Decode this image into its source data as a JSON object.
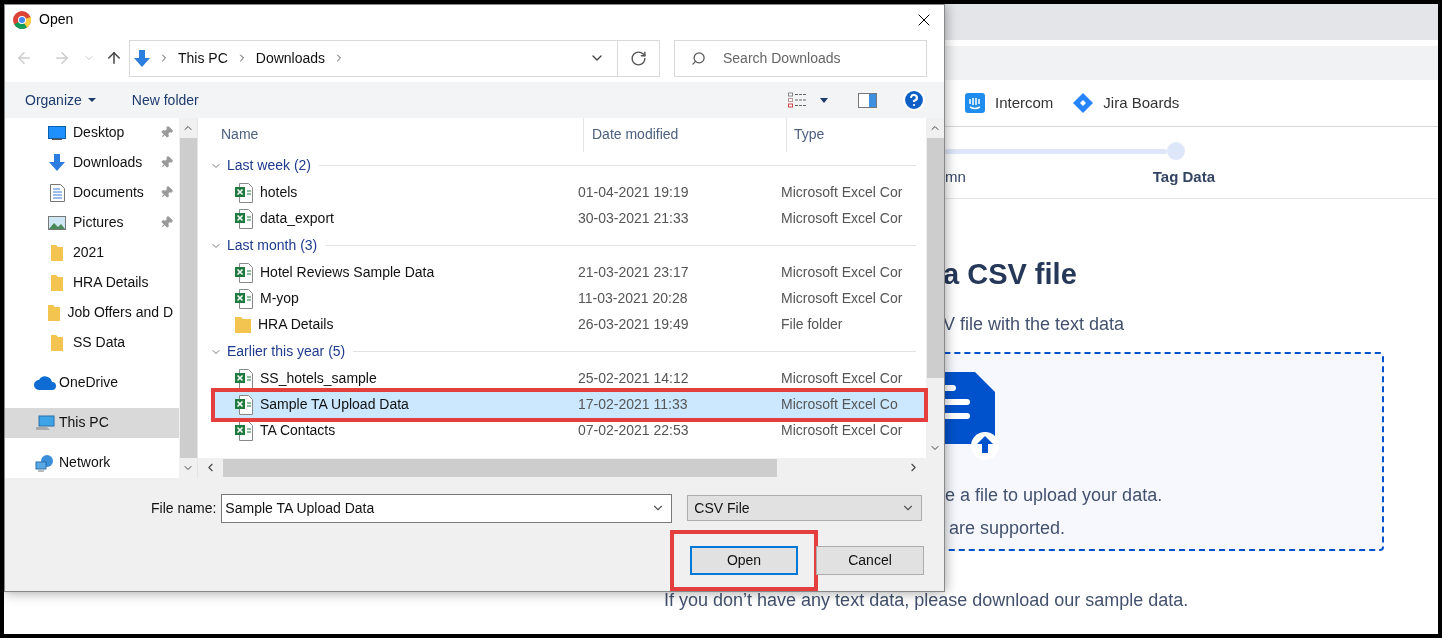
{
  "dialog": {
    "title": "Open",
    "breadcrumb": [
      "This PC",
      "Downloads"
    ],
    "search": {
      "placeholder": "Search Downloads"
    },
    "toolbar": {
      "organize": "Organize",
      "new_folder": "New folder"
    },
    "nav_pane": {
      "quick_access": [
        {
          "label": "Desktop",
          "kind": "desktop",
          "pinned": true,
          "selected": false
        },
        {
          "label": "Downloads",
          "kind": "downloads",
          "pinned": true,
          "selected": false
        },
        {
          "label": "Documents",
          "kind": "documents",
          "pinned": true,
          "selected": false
        },
        {
          "label": "Pictures",
          "kind": "pictures",
          "pinned": true,
          "selected": false
        },
        {
          "label": "2021",
          "kind": "folder",
          "pinned": false,
          "selected": false
        },
        {
          "label": "HRA Details",
          "kind": "folder",
          "pinned": false,
          "selected": false
        },
        {
          "label": "Job Offers and D",
          "kind": "folder",
          "pinned": false,
          "selected": false
        },
        {
          "label": "SS Data",
          "kind": "folder",
          "pinned": false,
          "selected": false
        }
      ],
      "locations": [
        {
          "label": "OneDrive",
          "kind": "cloud",
          "selected": false
        },
        {
          "label": "This PC",
          "kind": "pc",
          "selected": true
        },
        {
          "label": "Network",
          "kind": "network",
          "selected": false
        }
      ]
    },
    "columns": [
      "Name",
      "Date modified",
      "Type"
    ],
    "groups": [
      {
        "label": "Last week (2)",
        "expanded": true,
        "files": [
          {
            "name": "hotels",
            "date": "01-04-2021 19:19",
            "type": "Microsoft Excel Cor",
            "kind": "excel",
            "selected": false
          },
          {
            "name": "data_export",
            "date": "30-03-2021 21:33",
            "type": "Microsoft Excel Cor",
            "kind": "excel",
            "selected": false
          }
        ]
      },
      {
        "label": "Last month (3)",
        "expanded": true,
        "files": [
          {
            "name": "Hotel Reviews Sample Data",
            "date": "21-03-2021 23:17",
            "type": "Microsoft Excel Cor",
            "kind": "excel",
            "selected": false
          },
          {
            "name": "M-yop",
            "date": "11-03-2021 20:28",
            "type": "Microsoft Excel Cor",
            "kind": "excel",
            "selected": false
          },
          {
            "name": "HRA Details",
            "date": "26-03-2021 19:49",
            "type": "File folder",
            "kind": "folder",
            "selected": false
          }
        ]
      },
      {
        "label": "Earlier this year (5)",
        "expanded": true,
        "files": [
          {
            "name": "SS_hotels_sample",
            "date": "25-02-2021 14:12",
            "type": "Microsoft Excel Cor",
            "kind": "excel",
            "selected": false
          },
          {
            "name": "Sample TA Upload Data",
            "date": "17-02-2021 11:33",
            "type": "Microsoft Excel Co",
            "kind": "excel",
            "selected": true
          },
          {
            "name": "TA Contacts",
            "date": "07-02-2021 22:53",
            "type": "Microsoft Excel Cor",
            "kind": "excel",
            "selected": false
          }
        ]
      }
    ],
    "file_name": {
      "label": "File name:",
      "value": "Sample TA Upload Data"
    },
    "file_type": "CSV File",
    "buttons": [
      {
        "label": "Open",
        "kind": "primary"
      },
      {
        "label": "Cancel",
        "kind": "secondary"
      }
    ]
  },
  "page": {
    "bookmarks": [
      {
        "label": "Intercom",
        "kind": "intercom"
      },
      {
        "label": "Jira Boards",
        "kind": "jira"
      }
    ],
    "steps": [
      "mn",
      "Tag Data"
    ],
    "heading": "a CSV file",
    "subtitle": "V file with the text data",
    "dropzone_lines": [
      "e a file to upload your data.",
      "are supported."
    ],
    "footer": "If you don’t have any text data, please download our sample data."
  }
}
